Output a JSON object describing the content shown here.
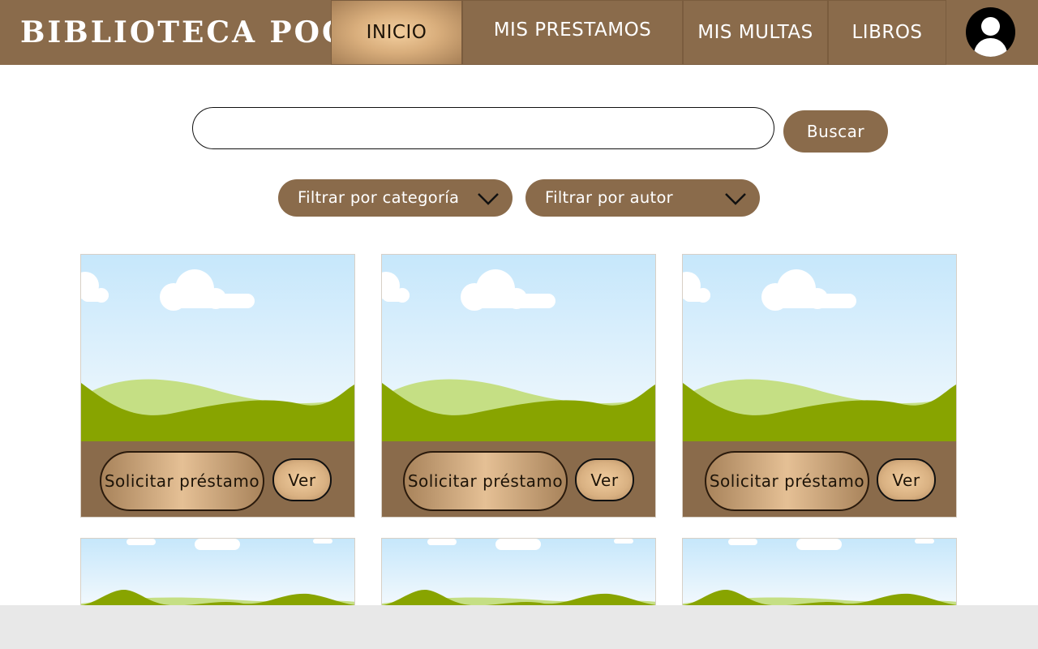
{
  "header": {
    "brand": "BIBLIOTECA POO",
    "nav": [
      {
        "label": "INICIO",
        "active": true
      },
      {
        "label": "MIS PRESTAMOS",
        "active": false
      },
      {
        "label": "MIS MULTAS",
        "active": false
      },
      {
        "label": "LIBROS",
        "active": false
      }
    ],
    "avatar_icon": "user-avatar-icon"
  },
  "search": {
    "value": "",
    "placeholder": "",
    "button_label": "Buscar"
  },
  "filters": [
    {
      "label": "Filtrar por categoría",
      "icon": "chevron-down-icon"
    },
    {
      "label": "Filtrar por autor",
      "icon": "chevron-down-icon"
    }
  ],
  "books": [
    {
      "image_icon": "landscape-placeholder-icon",
      "request_label": "Solicitar préstamo",
      "view_label": "Ver"
    },
    {
      "image_icon": "landscape-placeholder-icon",
      "request_label": "Solicitar préstamo",
      "view_label": "Ver"
    },
    {
      "image_icon": "landscape-placeholder-icon",
      "request_label": "Solicitar préstamo",
      "view_label": "Ver"
    }
  ],
  "colors": {
    "primary_brown": "#8a6b4b",
    "accent_gold": "#e5c095",
    "sky": "#c6e7fb",
    "grass_dark": "#88a400",
    "grass_light": "#c5df84"
  }
}
